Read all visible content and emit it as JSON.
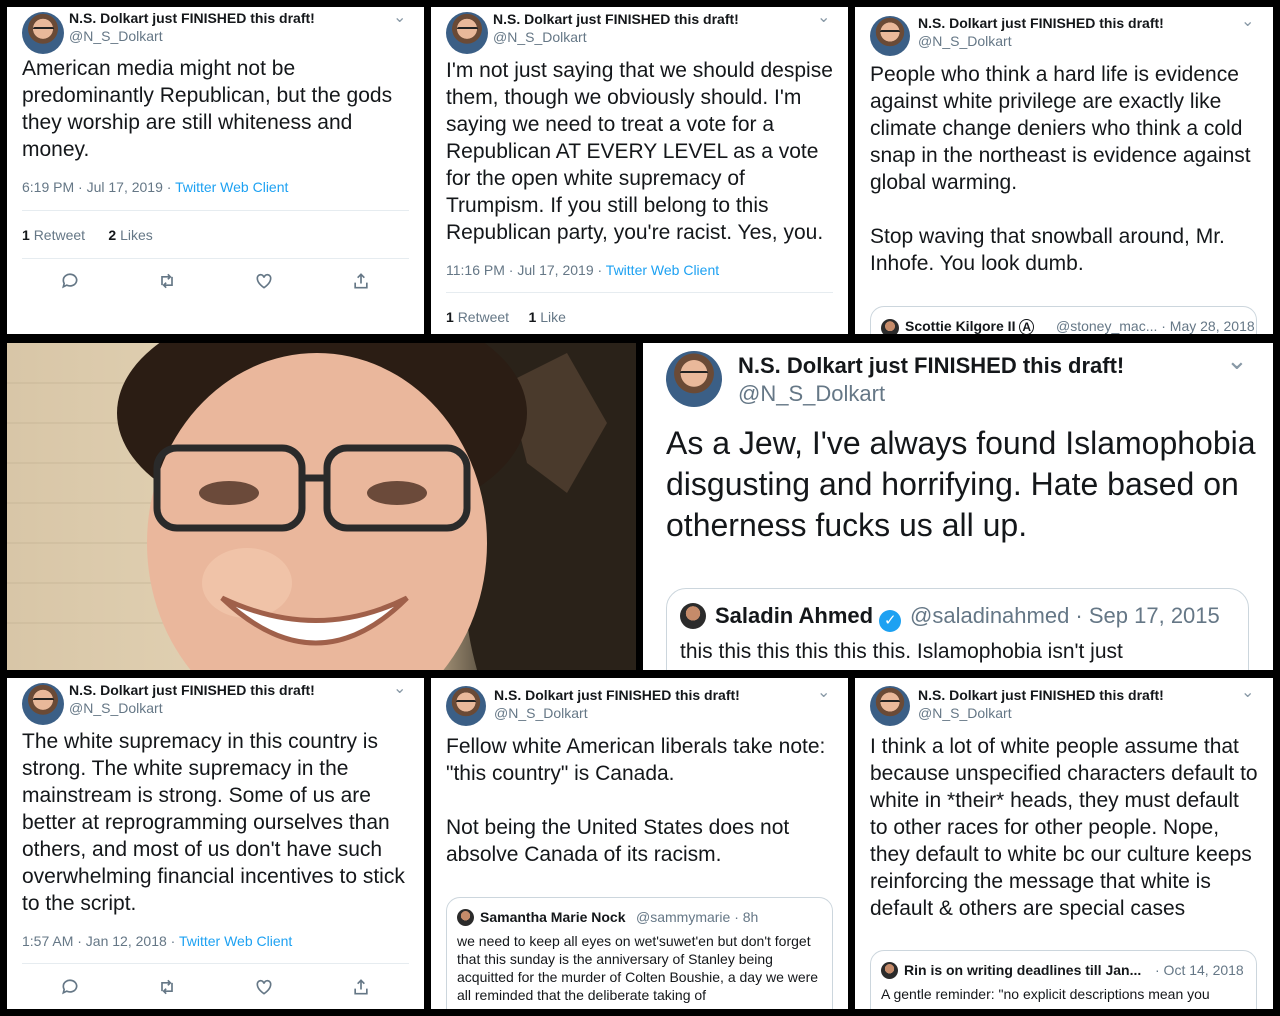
{
  "author": {
    "name": "N.S. Dolkart just FINISHED this draft!",
    "handle": "@N_S_Dolkart"
  },
  "tweets": [
    {
      "text": "American media might not be predominantly Republican, but the gods they worship are still whiteness and money.",
      "time": "6:19 PM · Jul 17, 2019 · ",
      "client": "Twitter Web Client",
      "retweets": "1",
      "retweets_label": "Retweet",
      "likes": "2",
      "likes_label": "Likes"
    },
    {
      "text": "I'm not just saying that we should despise them, though we obviously should. I'm saying we need to treat a vote for a Republican AT EVERY LEVEL as a vote for the open white supremacy of Trumpism. If you still belong to this Republican party, you're racist. Yes, you.",
      "time": "11:16 PM · Jul 17, 2019 · ",
      "client": "Twitter Web Client",
      "retweets": "1",
      "retweets_label": "Retweet",
      "likes": "1",
      "likes_label": "Like"
    },
    {
      "text": "People who think a hard life is evidence against white privilege are exactly like climate change deniers who think a cold snap in the northeast is evidence against global warming.",
      "text2": "Stop waving that snowball around, Mr. Inhofe. You look dumb.",
      "quote_name": "Scottie Kilgore II ",
      "quote_handle": "@stoney_mac... · May 28, 2018"
    },
    {
      "text": "As a Jew, I've always found Islamophobia disgusting and horrifying. Hate based on otherness fucks us all up.",
      "quote_name": "Saladin Ahmed",
      "quote_handle": "@saladinahmed · Sep 17, 2015",
      "quote_text": "this this this this this this. Islamophobia isn't just"
    },
    {
      "text": "The white supremacy in this country is strong. The white supremacy in the mainstream is strong. Some of us are better at reprogramming ourselves than others, and most of us don't have such overwhelming financial incentives to stick to the script.",
      "time": "1:57 AM · Jan 12, 2018 · ",
      "client": "Twitter Web Client"
    },
    {
      "text": "Fellow white American liberals take note: \"this country\" is Canada.",
      "text2": "Not being the United States does not absolve Canada of its racism.",
      "quote_name": "Samantha Marie Nock",
      "quote_handle": "@sammymarie · 8h",
      "quote_text": "we need to keep all eyes on wet'suwet'en but don't forget that this sunday is the anniversary of Stanley being acquitted for the murder of Colten Boushie, a day we were all reminded that the deliberate taking of"
    },
    {
      "text": "I think a lot of white people assume that because unspecified characters default to white in *their* heads, they must default to other races for other people. Nope, they default to white bc our culture keeps reinforcing the message that white is default & others are special cases",
      "quote_name": "Rin is on writing deadlines till Jan...",
      "quote_handle": "· Oct 14, 2018",
      "quote_text": "A gentle reminder: \"no explicit descriptions mean you"
    }
  ],
  "icons": [
    "reply-icon",
    "retweet-icon",
    "like-icon",
    "share-icon",
    "chevron-down-icon",
    "verified-icon"
  ],
  "colors": {
    "link": "#1da1f2",
    "secondary": "#657786",
    "verified": "#1da1f2"
  }
}
